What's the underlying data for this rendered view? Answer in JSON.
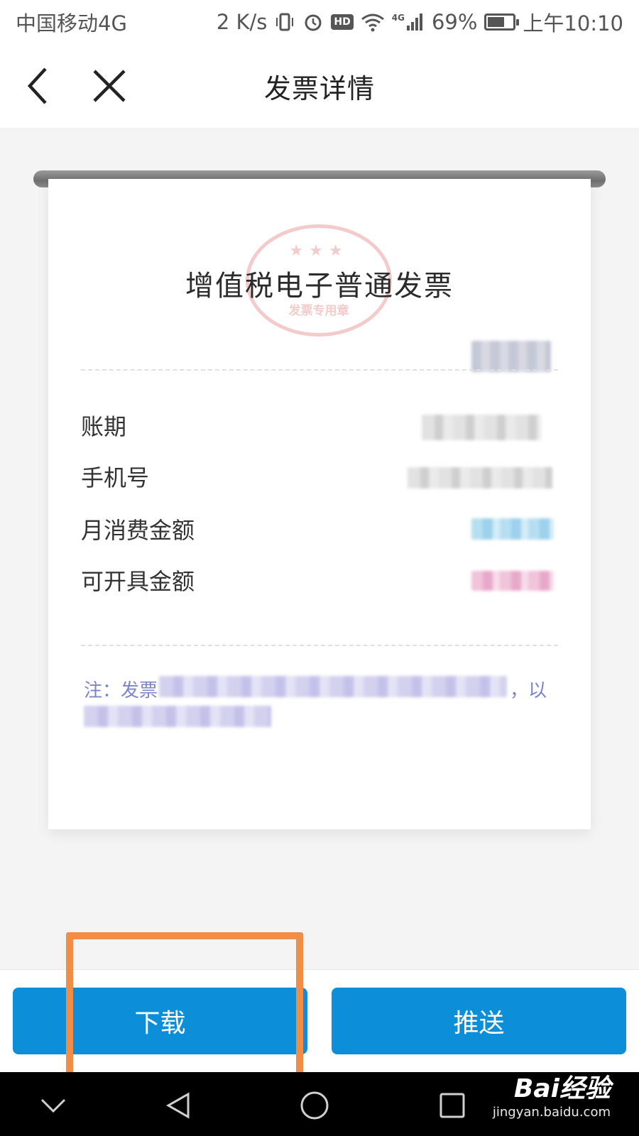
{
  "status_bar": {
    "carrier": "中国移动4G",
    "net_speed": "2 K/s",
    "hd_label": "HD",
    "net_type": "4G",
    "battery_percent": "69%",
    "battery_level": 0.69,
    "time": "上午10:10"
  },
  "nav": {
    "title": "发票详情"
  },
  "receipt": {
    "title": "增值税电子普通发票",
    "stamp_text": "发票专用章",
    "rows": [
      {
        "label": "账期"
      },
      {
        "label": "手机号"
      },
      {
        "label": "月消费金额"
      },
      {
        "label": "可开具金额"
      }
    ],
    "note_prefix": "注：发票",
    "note_suffix": "，以"
  },
  "actions": {
    "download_label": "下载",
    "push_label": "推送"
  },
  "watermark": {
    "logo": "Bai经验",
    "domain": "jingyan.baidu.com"
  },
  "colors": {
    "primary_button": "#0d8ed8",
    "highlight": "#f08e48",
    "note_text": "#7d84c9"
  }
}
